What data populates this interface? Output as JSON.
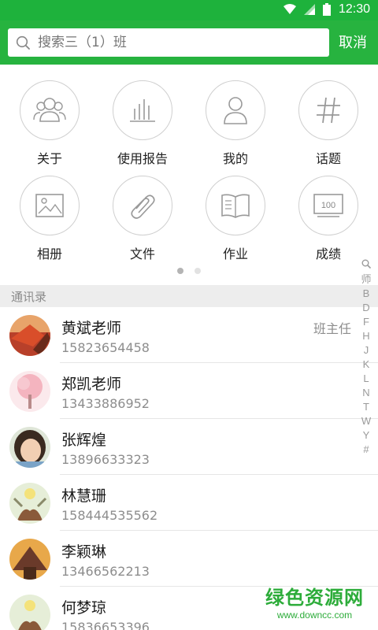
{
  "status_bar": {
    "time": "12:30",
    "icons": [
      "wifi-icon",
      "signal-icon",
      "battery-icon"
    ]
  },
  "search": {
    "placeholder": "搜索三（1）班",
    "cancel_label": "取消"
  },
  "grid": {
    "items": [
      {
        "label": "关于",
        "icon": "group-icon"
      },
      {
        "label": "使用报告",
        "icon": "bar-chart-icon"
      },
      {
        "label": "我的",
        "icon": "person-icon"
      },
      {
        "label": "话题",
        "icon": "hashtag-icon"
      },
      {
        "label": "相册",
        "icon": "image-icon"
      },
      {
        "label": "文件",
        "icon": "paperclip-icon"
      },
      {
        "label": "作业",
        "icon": "book-icon"
      },
      {
        "label": "成绩",
        "icon": "score-icon",
        "badge_text": "100"
      }
    ],
    "pager": {
      "pages": 2,
      "current": 1
    }
  },
  "contacts_section": {
    "title": "通讯录",
    "items": [
      {
        "name": "黄斌老师",
        "phone": "15823654458",
        "role": "班主任"
      },
      {
        "name": "郑凯老师",
        "phone": "13433886952"
      },
      {
        "name": "张辉煌",
        "phone": "13896633323"
      },
      {
        "name": "林慧珊",
        "phone": "158444535562"
      },
      {
        "name": "李颖琳",
        "phone": "13466562213"
      },
      {
        "name": "何梦琼",
        "phone": "15836653396"
      }
    ]
  },
  "alpha_index": [
    "search",
    "师",
    "B",
    "D",
    "F",
    "H",
    "J",
    "K",
    "L",
    "N",
    "T",
    "W",
    "Y",
    "#"
  ],
  "watermark": {
    "line1": "绿色资源网",
    "line2": "www.downcc.com"
  },
  "colors": {
    "brand": "#27b33f",
    "status_bar": "#1eb23c",
    "watermark": "#2dac3a"
  }
}
